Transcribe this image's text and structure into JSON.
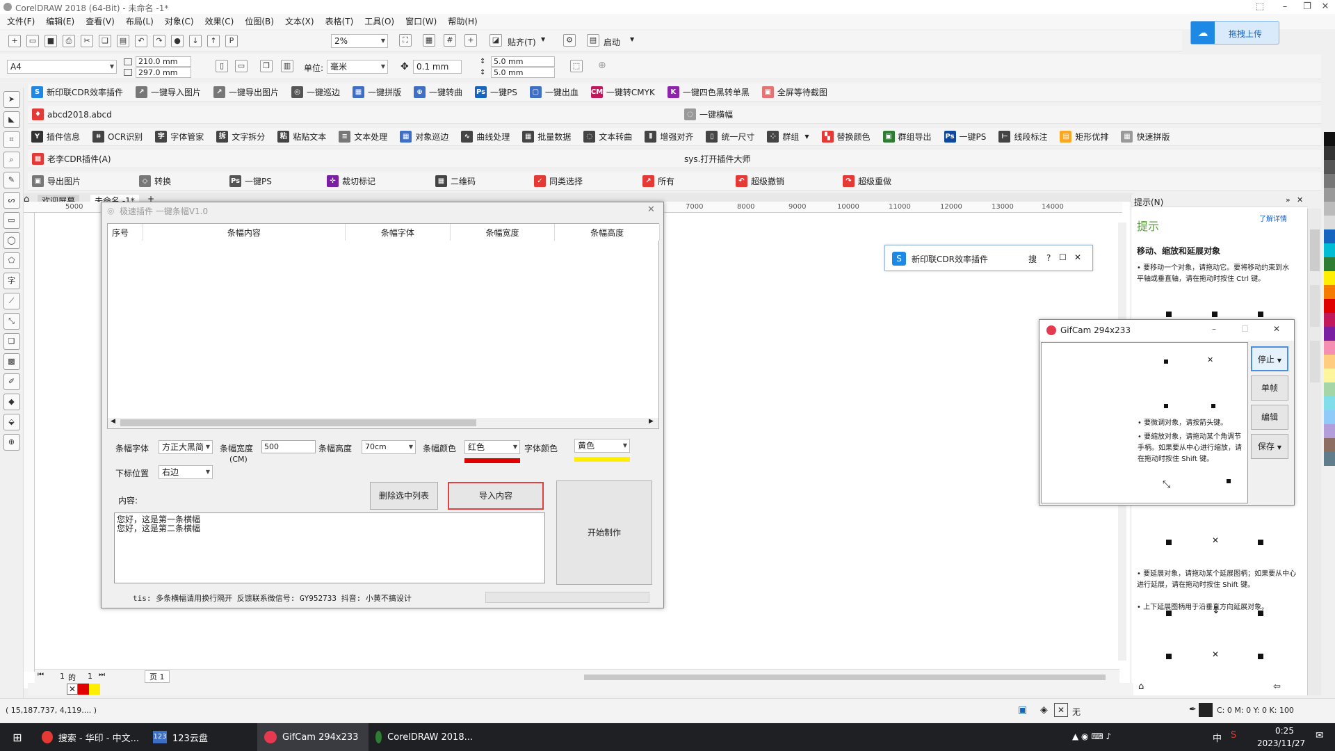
{
  "window": {
    "title": "CorelDRAW 2018 (64-Bit) - 未命名 -1*",
    "upload_label": "拖拽上传"
  },
  "menu": [
    "文件(F)",
    "编辑(E)",
    "查看(V)",
    "布局(L)",
    "对象(C)",
    "效果(C)",
    "位图(B)",
    "文本(X)",
    "表格(T)",
    "工具(O)",
    "窗口(W)",
    "帮助(H)"
  ],
  "toolbar": {
    "zoom": "2%",
    "snap_label": "贴齐(T)",
    "launch_label": "启动"
  },
  "propbar": {
    "page_size": "A4",
    "width": "210.0 mm",
    "height": "297.0 mm",
    "unit_label": "单位:",
    "unit": "毫米",
    "nudge": "0.1 mm",
    "dup_x": "5.0 mm",
    "dup_y": "5.0 mm"
  },
  "plugins": {
    "row1": [
      "新印联CDR效率插件",
      "一键导入图片",
      "一键导出图片",
      "一键巡边",
      "一键拼版",
      "一键转曲",
      "一键PS",
      "一键出血",
      "一键转CMYK",
      "一键四色黑转单黑",
      "全屏等待截图"
    ],
    "file_label": "abcd2018.abcd",
    "banner_label": "一键横幅",
    "row3": [
      "插件信息",
      "OCR识别",
      "字体管家",
      "文字拆分",
      "粘贴文本",
      "文本处理",
      "对象巡边",
      "曲线处理",
      "批量数据",
      "文本转曲",
      "增强对齐",
      "统一尺寸",
      "群组",
      "替换颜色",
      "群组导出",
      "一键PS",
      "线段标注",
      "矩形优排",
      "快速拼版"
    ],
    "laoli_label": "老李CDR插件(A)",
    "sys_label": "sys.打开插件大师",
    "row5": [
      "导出图片",
      "转换",
      "一键PS",
      "裁切标记",
      "二维码",
      "同类选择",
      "所有",
      "超级撤销",
      "超级重做"
    ]
  },
  "tabs": {
    "welcome": "欢迎屏幕",
    "doc": "未命名 -1*"
  },
  "ruler": [
    "5000",
    "7000",
    "8000",
    "9000",
    "10000",
    "11000",
    "12000",
    "13000",
    "14000"
  ],
  "dialog": {
    "title": "极速插件 一键条幅V1.0",
    "columns": [
      "序号",
      "条幅内容",
      "条幅字体",
      "条幅宽度",
      "条幅高度"
    ],
    "font_label": "条幅字体",
    "font_value": "方正大黑简",
    "width_label": "条幅宽度",
    "width_unit": "(CM)",
    "width_value": "500",
    "height_label": "条幅高度",
    "height_value": "70cm",
    "color_label": "条幅颜色",
    "color_value": "红色",
    "font_color_label": "字体颜色",
    "font_color_value": "黄色",
    "pos_label": "下标位置",
    "pos_value": "右边",
    "content_label": "内容:",
    "content_text": "您好，这是第一条横幅\n您好，这是第二条横幅",
    "delete_btn": "删除选中列表",
    "import_btn": "导入内容",
    "start_btn": "开始制作",
    "tip": "tis: 多条横幅请用换行隔开 反馈联系微信号: GY952733   抖音: 小黄不搞设计"
  },
  "xinyin": {
    "title": "新印联CDR效率插件",
    "search": "搜",
    "help": "?"
  },
  "hint": {
    "header": "提示(N)",
    "title": "提示",
    "learn": "了解详情",
    "heading": "移动、缩放和延展对象",
    "p1": "• 要移动一个对象，请拖动它。要将移动约束到水平轴或垂直轴，请在拖动时按住 Ctrl 键。",
    "p2": "• 要微调对象，请按箭头键。",
    "p3": "• 要缩放对象，请拖动某个角调节手柄。如果要从中心进行缩放，请在拖动时按住 Shift 键。",
    "p4": "• 要延展对象，请拖动某个延展图柄；如果要从中心进行延展，请在拖动时按住 Shift 键。",
    "p5": "• 上下延展图柄用于沿垂直方向延展对象。"
  },
  "gifcam": {
    "title": "GifCam 294x233",
    "stop": "停止",
    "single": "单帧",
    "edit": "编辑",
    "save": "保存"
  },
  "pagenav": {
    "current": "1",
    "of": "的",
    "total": "1",
    "page_tab": "页 1"
  },
  "status": {
    "coords": "( 15,187.737, 4,119.... )",
    "fill": "无",
    "color": "C: 0 M: 0 Y: 0 K: 100"
  },
  "taskbar": {
    "items": [
      "搜索 - 华印 - 中文...",
      "123云盘",
      "GifCam 294x233",
      "CorelDRAW 2018..."
    ],
    "ime": "中",
    "time": "0:25",
    "date": "2023/11/27"
  },
  "colors": {
    "accent": "#1e88e5",
    "red": "#e00000",
    "yellow": "#ffee00"
  }
}
